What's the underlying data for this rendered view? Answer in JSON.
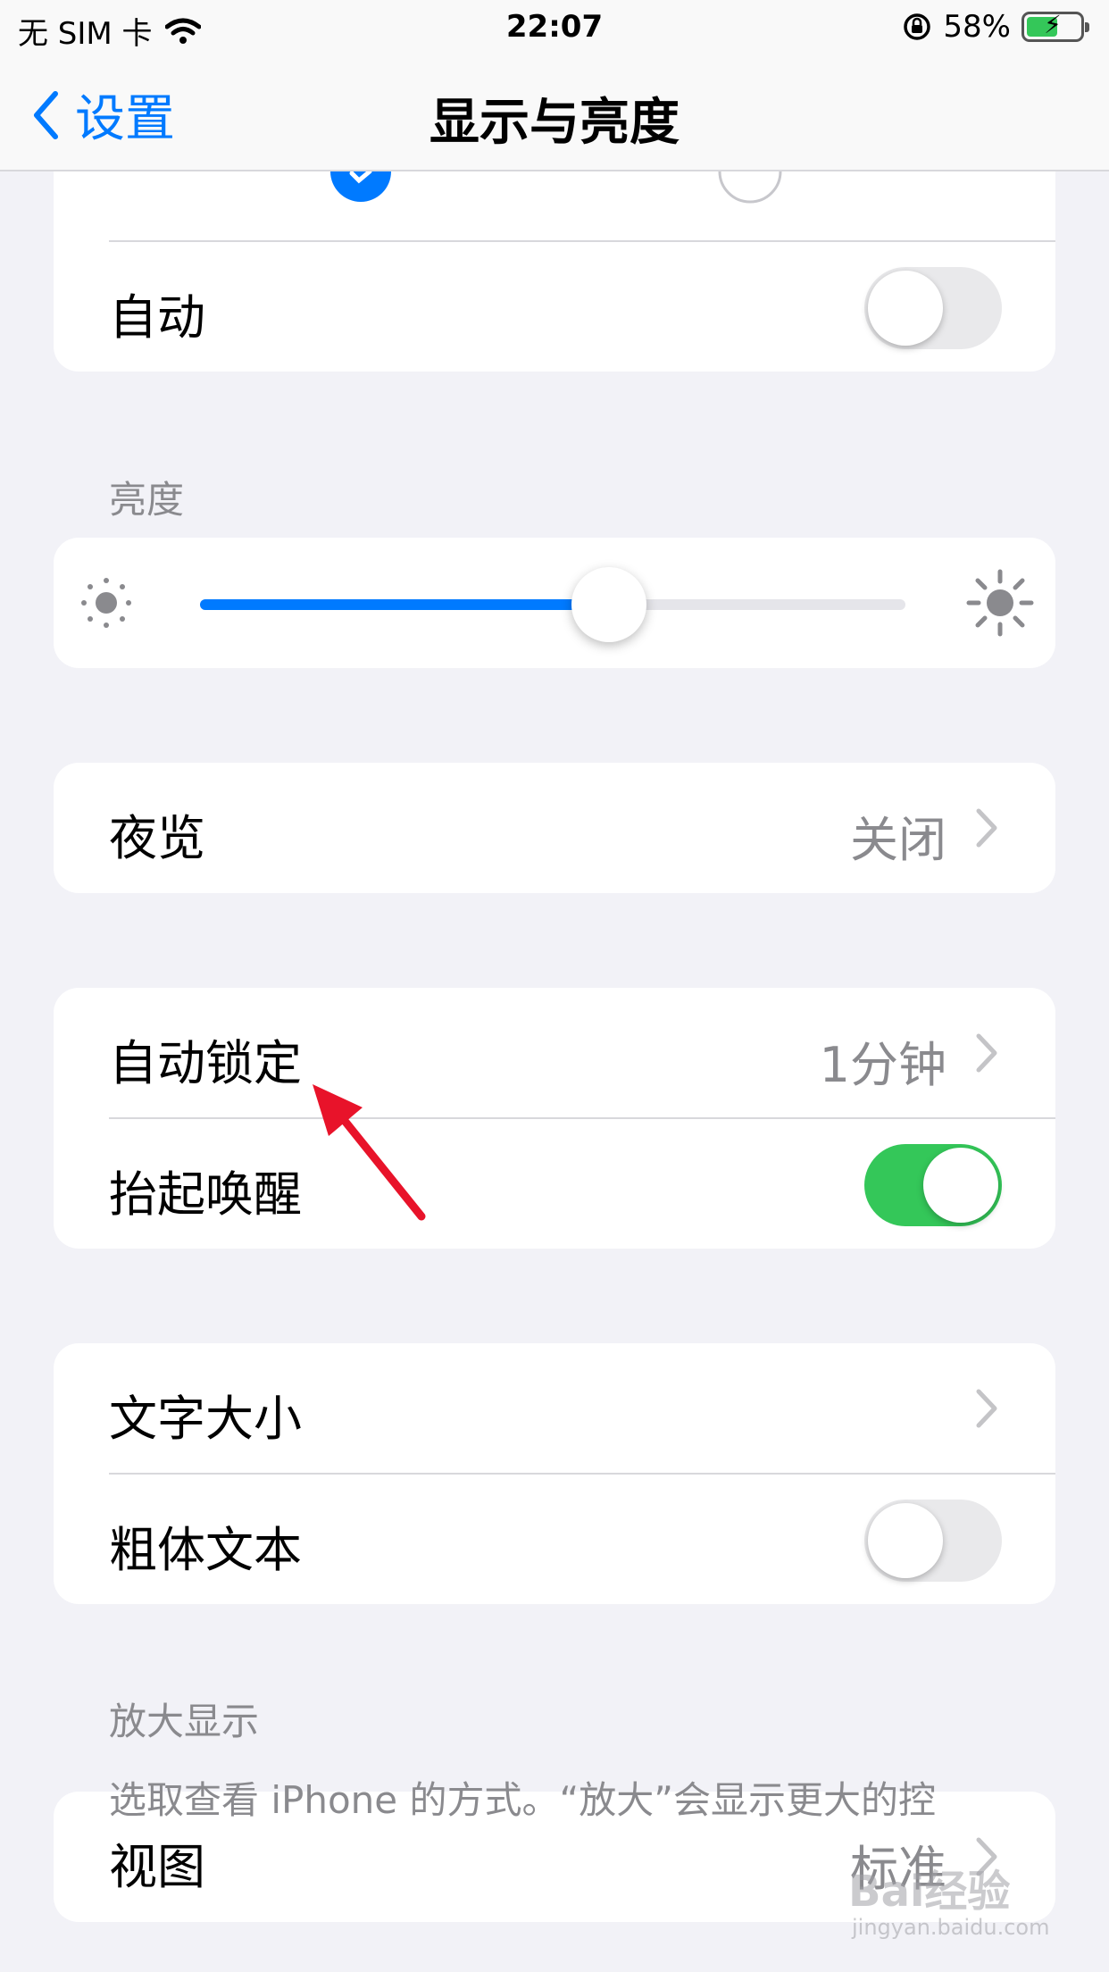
{
  "status_bar": {
    "carrier": "无 SIM 卡",
    "time": "22:07",
    "battery_percent": "58%",
    "battery_level": 0.58,
    "icons": [
      "wifi-icon",
      "rotation-lock-icon",
      "battery-charging-icon"
    ]
  },
  "nav": {
    "back_label": "设置",
    "title": "显示与亮度"
  },
  "appearance": {
    "auto_label": "自动",
    "auto_on": false,
    "selected_option": "light"
  },
  "brightness": {
    "header": "亮度",
    "level": 0.58,
    "icons": [
      "sun-small-icon",
      "sun-large-icon"
    ]
  },
  "night_shift": {
    "label": "夜览",
    "value": "关闭"
  },
  "lock": {
    "auto_lock_label": "自动锁定",
    "auto_lock_value": "1分钟",
    "raise_to_wake_label": "抬起唤醒",
    "raise_to_wake_on": true
  },
  "text": {
    "text_size_label": "文字大小",
    "bold_text_label": "粗体文本",
    "bold_text_on": false
  },
  "zoom": {
    "header": "放大显示",
    "view_label": "视图",
    "view_value": "标准",
    "footer": "选取查看 iPhone 的方式。“放大”会显示更大的控"
  },
  "watermark": {
    "brand": "Bai经验",
    "url": "jingyan.baidu.com"
  },
  "colors": {
    "accent": "#007aff",
    "toggle_on": "#34c759",
    "annotation_arrow": "#e8132a"
  }
}
